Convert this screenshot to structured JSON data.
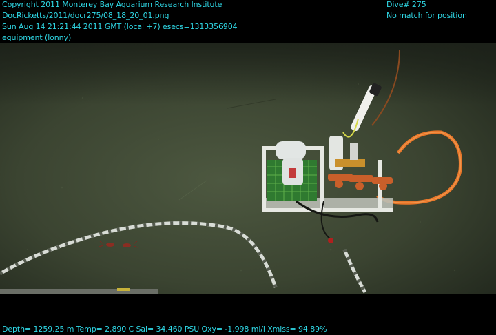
{
  "overlay": {
    "copyright": "Copyright 2011 Monterey Bay Aquarium Research Institute",
    "file_path": "DocRicketts/2011/docr275/08_18_20_01.png",
    "timestamp": "Sun Aug 14 21:21:44 2011 GMT (local +7)  esecs=1313356904",
    "category": "equipment (lonny)",
    "dive": "Dive# 275",
    "position_status": "No match for position",
    "sensor_line": "Depth= 1259.25 m  Temp= 2.890 C  Sal= 34.460 PSU  Oxy= -1.998 ml/l  Xmiss= 94.89%"
  },
  "colors": {
    "overlay_text": "#2fd8e6",
    "seafloor": "#3d4632",
    "cable_orange": "#e8772a"
  }
}
